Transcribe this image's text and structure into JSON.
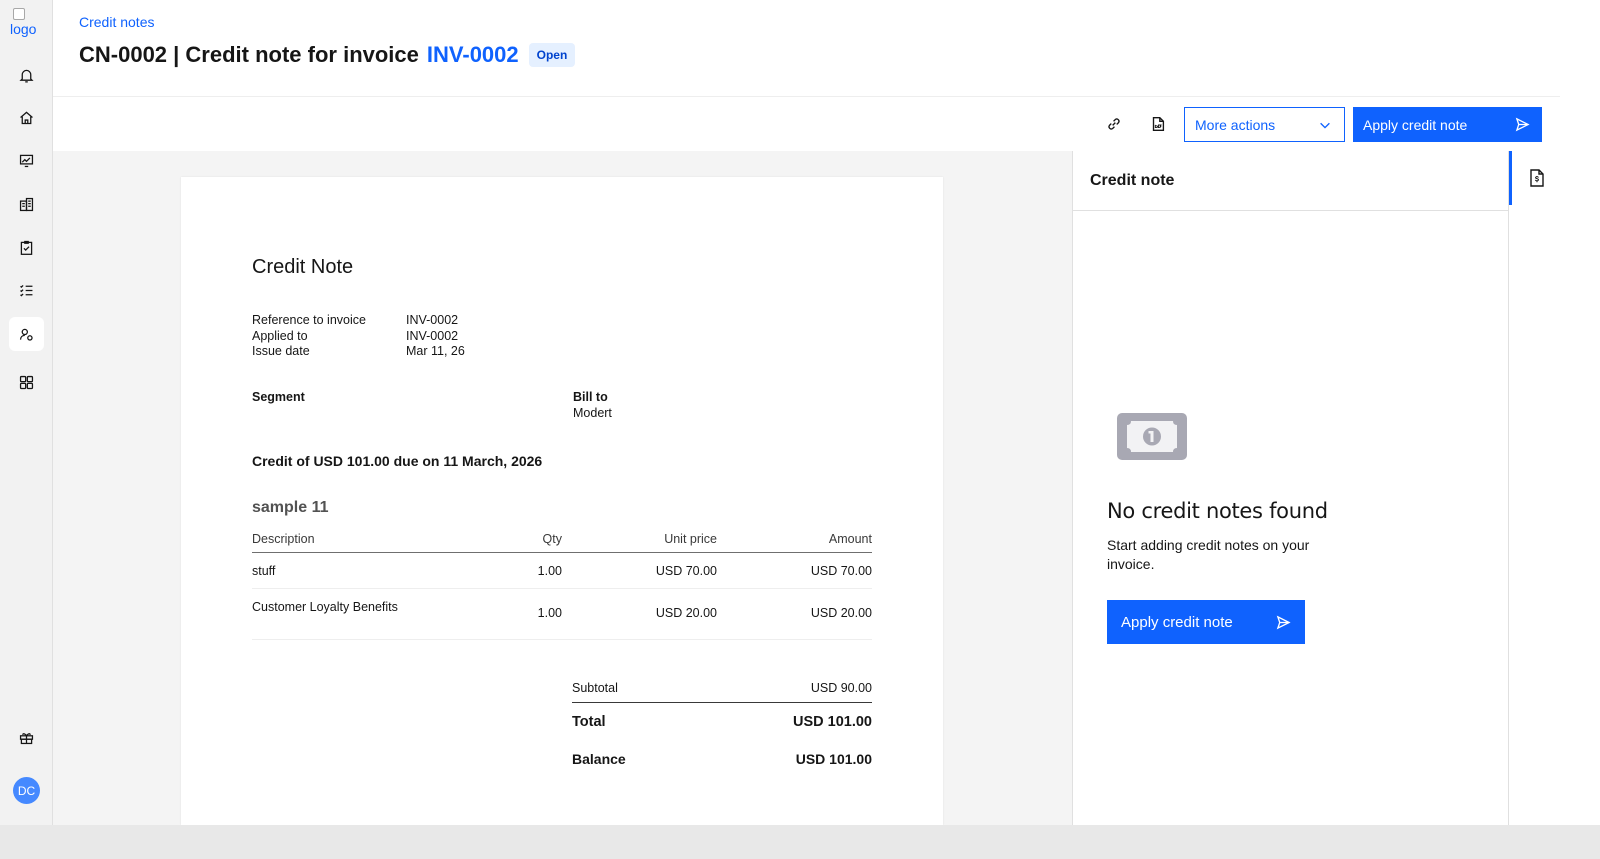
{
  "logo": {
    "alt": "logo"
  },
  "sidebar": {
    "items": [
      {
        "icon": "bell-icon"
      },
      {
        "icon": "home-icon"
      },
      {
        "icon": "analytics-icon"
      },
      {
        "icon": "building-icon"
      },
      {
        "icon": "clipboard-check-icon"
      },
      {
        "icon": "task-list-icon"
      },
      {
        "icon": "user-settings-icon",
        "active": true
      },
      {
        "icon": "apps-grid-icon"
      },
      {
        "icon": "gift-icon"
      }
    ],
    "avatar_initials": "DC"
  },
  "header": {
    "breadcrumb": "Credit notes",
    "title_prefix": "CN-0002 | Credit note for invoice",
    "invoice_link": "INV-0002",
    "status": "Open"
  },
  "toolbar": {
    "link_icon": "link-icon",
    "pdf_icon": "pdf-icon",
    "more_actions_label": "More actions",
    "apply_label": "Apply credit note"
  },
  "document": {
    "title": "Credit Note",
    "meta": [
      {
        "label": "Reference to invoice",
        "value": "INV-0002"
      },
      {
        "label": "Applied to",
        "value": "INV-0002"
      },
      {
        "label": "Issue date",
        "value": "Mar 11, 26"
      }
    ],
    "segment_label": "Segment",
    "bill_to_label": "Bill to",
    "bill_to_value": "Modert",
    "credit_line": "Credit of USD 101.00 due on 11 March, 2026",
    "section_title": "sample 11",
    "columns": {
      "description": "Description",
      "qty": "Qty",
      "unit_price": "Unit price",
      "amount": "Amount"
    },
    "items": [
      {
        "description": "stuff",
        "qty": "1.00",
        "unit_price": "USD 70.00",
        "amount": "USD 70.00"
      },
      {
        "description": "Customer Loyalty Benefits",
        "qty": "1.00",
        "unit_price": "USD 20.00",
        "amount": "USD 20.00"
      }
    ],
    "subtotal_label": "Subtotal",
    "subtotal_value": "USD 90.00",
    "total_label": "Total",
    "total_value": "USD 101.00",
    "balance_label": "Balance",
    "balance_value": "USD 101.00"
  },
  "panel": {
    "title": "Credit note",
    "empty_icon": "money-icon",
    "empty_title": "No credit notes found",
    "empty_text": "Start adding credit notes on your invoice.",
    "apply_label": "Apply credit note",
    "rail_icon": "document-dollar-icon"
  },
  "colors": {
    "primary": "#0f62fe",
    "badge_bg": "#e5f0ff",
    "sidebar_bg": "#f2f2f2"
  }
}
